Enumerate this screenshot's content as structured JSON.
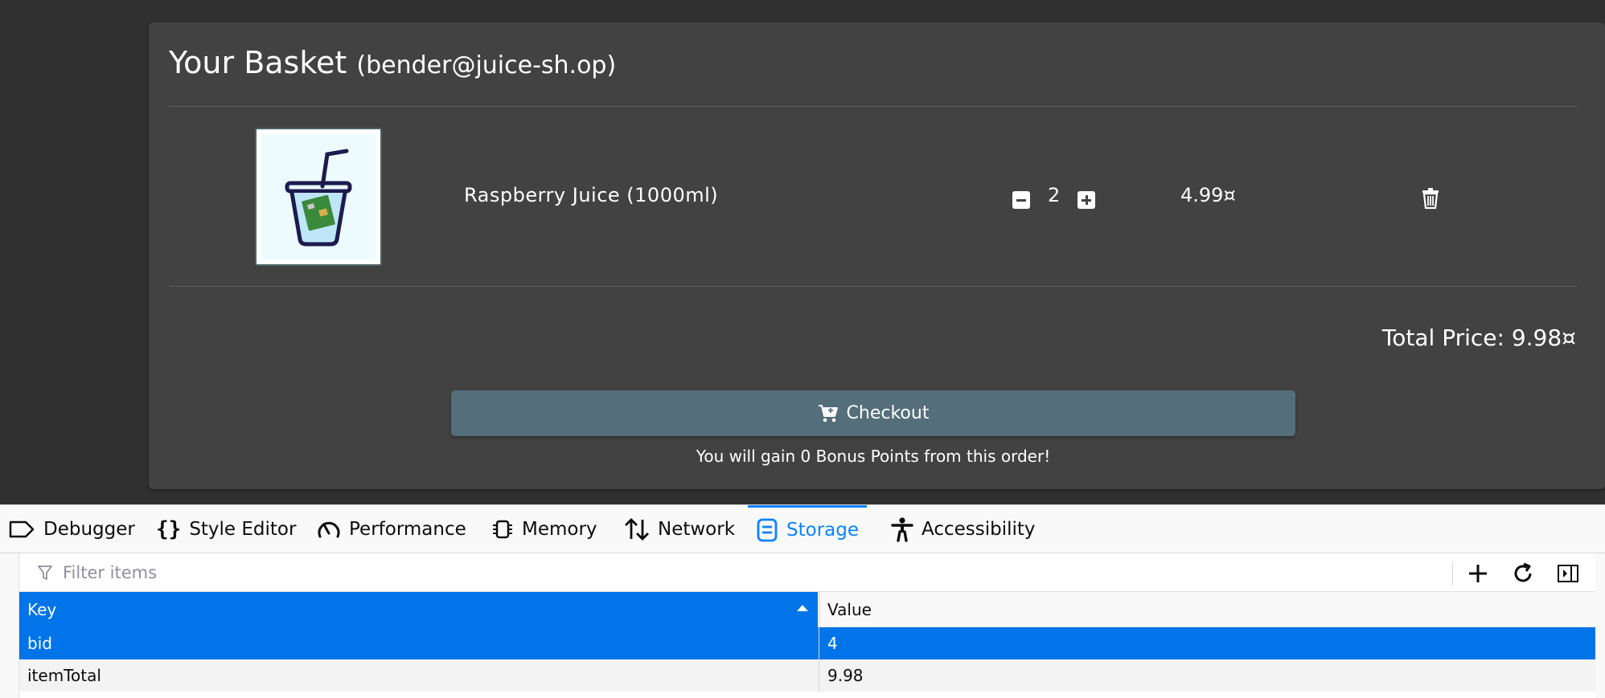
{
  "basket": {
    "title": "Your Basket",
    "email": "(bender@juice-sh.op)",
    "item": {
      "name": "Raspberry Juice (1000ml)",
      "quantity": "2",
      "price": "4.99¤"
    },
    "total_price": "Total Price: 9.98¤",
    "checkout_label": "Checkout",
    "bonus_text": "You will gain 0 Bonus Points from this order!"
  },
  "devtools": {
    "tabs": [
      {
        "label": "Debugger",
        "icon": "debugger-icon"
      },
      {
        "label": "Style Editor",
        "icon": "braces-icon"
      },
      {
        "label": "Performance",
        "icon": "gauge-icon"
      },
      {
        "label": "Memory",
        "icon": "chip-icon"
      },
      {
        "label": "Network",
        "icon": "arrows-updown-icon"
      },
      {
        "label": "Storage",
        "icon": "storage-icon",
        "active": true
      },
      {
        "label": "Accessibility",
        "icon": "accessibility-icon"
      }
    ],
    "filter_placeholder": "Filter items",
    "table": {
      "columns": [
        "Key",
        "Value"
      ],
      "rows": [
        {
          "key": "bid",
          "value": "4",
          "selected": true
        },
        {
          "key": "itemTotal",
          "value": "9.98",
          "selected": false
        }
      ]
    }
  },
  "colors": {
    "card_bg": "#424242",
    "page_bg": "#303030",
    "checkout_bg": "#546e7a",
    "devtools_accent": "#0a84ff",
    "selection_bg": "#0074e8"
  }
}
